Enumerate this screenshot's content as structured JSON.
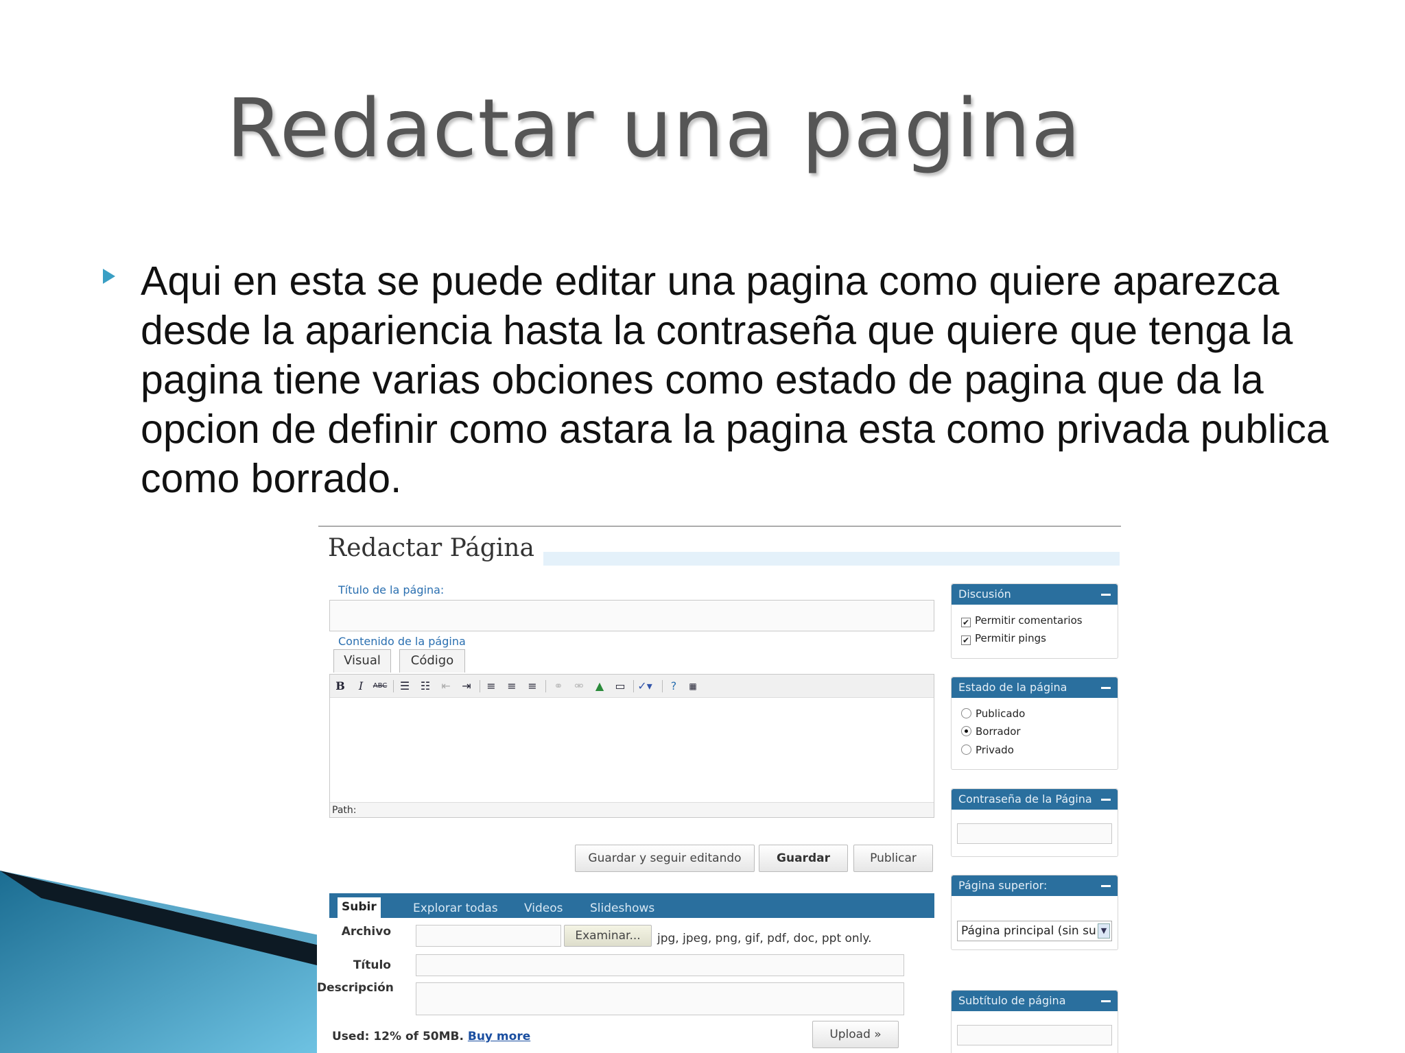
{
  "slide": {
    "title": "Redactar una pagina",
    "bullet_text": "Aqui en esta se puede editar una pagina como quiere aparezca desde la apariencia hasta la contraseña que quiere que tenga la pagina tiene varias obciones como estado de pagina que da la opcion de definir como astara la pagina esta como privada publica como borrado."
  },
  "editor": {
    "heading": "Redactar Página",
    "title_label": "Título de la página:",
    "content_label": "Contenido de la página",
    "tabs": [
      "Visual",
      "Código"
    ],
    "path_label": "Path:",
    "buttons": {
      "save_continue": "Guardar y seguir editando",
      "save": "Guardar",
      "publish": "Publicar"
    }
  },
  "upload": {
    "tabs": [
      "Subir",
      "Explorar todas",
      "Videos",
      "Slideshows"
    ],
    "file_label": "Archivo",
    "browse_button": "Examinar...",
    "formats_note": "jpg, jpeg, png, gif, pdf, doc, ppt only.",
    "title_label": "Título",
    "description_label": "Descripción",
    "used_text": "Used: 12% of 50MB.",
    "buy_more": "Buy more",
    "upload_button": "Upload »"
  },
  "sidebar": {
    "discussion": {
      "title": "Discusión",
      "options": [
        "Permitir comentarios",
        "Permitir pings"
      ]
    },
    "status": {
      "title": "Estado de la página",
      "options": [
        "Publicado",
        "Borrador",
        "Privado"
      ],
      "selected": "Borrador"
    },
    "password": {
      "title": "Contraseña de la Página"
    },
    "parent": {
      "title": "Página superior:",
      "selected": "Página principal (sin su"
    },
    "subtitle": {
      "title": "Subtítulo de página"
    }
  },
  "colors": {
    "accent_blue": "#2a6f9e",
    "bullet": "#3a9fc4",
    "title_gray": "#555555"
  }
}
